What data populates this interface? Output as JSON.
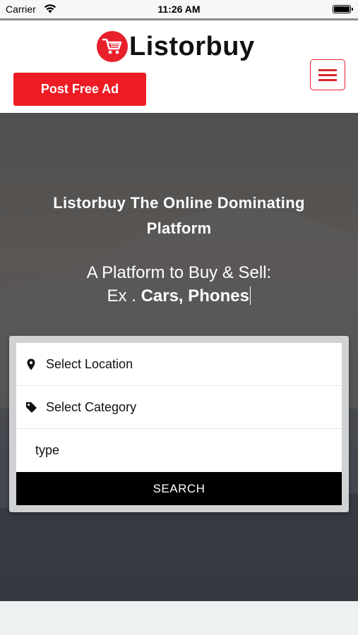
{
  "status_bar": {
    "carrier": "Carrier",
    "time": "11:26 AM"
  },
  "header": {
    "logo_text": "Listorbuy",
    "post_ad_label": "Post Free Ad",
    "menu_icon": "hamburger-menu-icon"
  },
  "hero": {
    "title": "Listorbuy The Online Dominating Platform",
    "subtitle_line1": "A Platform to Buy & Sell:",
    "subtitle_prefix": "Ex . ",
    "subtitle_typed": "Cars, Phones"
  },
  "search": {
    "location_placeholder": "Select Location",
    "category_placeholder": "Select Category",
    "type_placeholder": "type",
    "search_label": "SEARCH"
  },
  "colors": {
    "brand_red": "#ed1c24",
    "search_button": "#000000"
  }
}
